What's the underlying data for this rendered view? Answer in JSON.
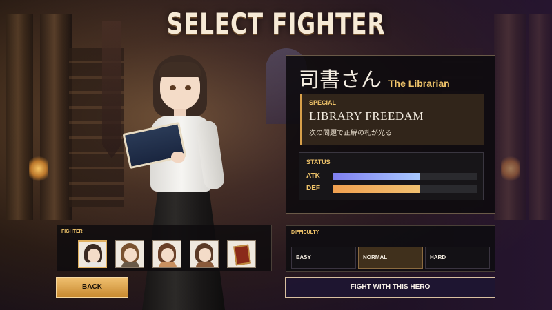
{
  "screen": {
    "title": "SELECT FIGHTER"
  },
  "fighter": {
    "name_jp": "司書さん",
    "name_en": "The Librarian",
    "special": {
      "label": "SPECIAL",
      "name": "LIBRARY FREEDAM",
      "description": "次の問題で正解の札が光る"
    },
    "status": {
      "label": "STATUS",
      "stats": [
        {
          "label": "ATK",
          "value": 0.6
        },
        {
          "label": "DEF",
          "value": 0.6
        }
      ]
    }
  },
  "selector": {
    "label": "FIGHTER",
    "thumbnails": [
      {
        "icon": "librarian-portrait",
        "hair": "#3a2a22",
        "body": "#e8e6e2",
        "selected": true
      },
      {
        "icon": "explorer-portrait",
        "hair": "#7a5230",
        "body": "#6a5a48",
        "selected": false
      },
      {
        "icon": "brown-hair-girl-portrait",
        "hair": "#6a4028",
        "body": "#c89060",
        "selected": false
      },
      {
        "icon": "student-portrait",
        "hair": "#5a3a26",
        "body": "#8a5a3a",
        "selected": false
      },
      {
        "icon": "red-book-icon",
        "hair": "",
        "body": "",
        "selected": false
      }
    ],
    "back_label": "BACK"
  },
  "difficulty": {
    "label": "DIFFICULTY",
    "options": [
      {
        "label": "EASY",
        "active": false
      },
      {
        "label": "NORMAL",
        "active": true
      },
      {
        "label": "HARD",
        "active": false
      }
    ],
    "confirm_label": "FIGHT WITH THIS HERO"
  },
  "colors": {
    "accent_gold": "#f0c46a",
    "atk_bar": "#a8c8ff",
    "def_bar": "#f0a050"
  }
}
